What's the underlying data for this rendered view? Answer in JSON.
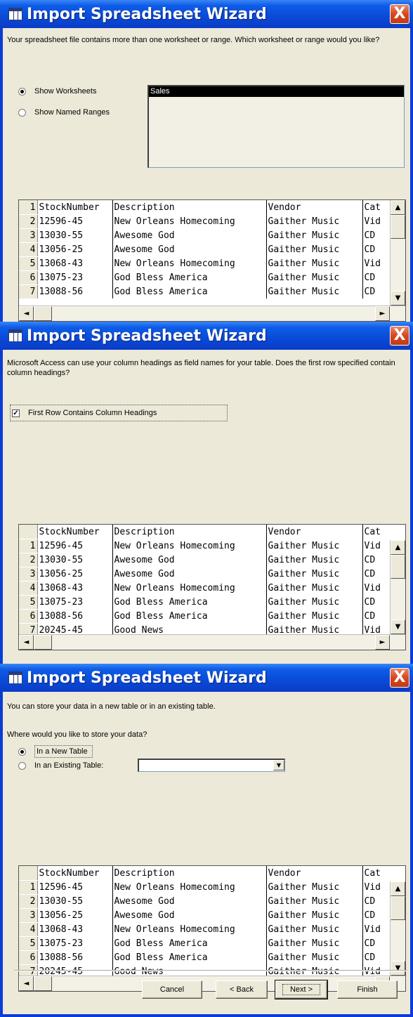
{
  "window_title": "Import Spreadsheet Wizard",
  "close_label": "X",
  "step1": {
    "prompt": "Your spreadsheet file contains more than one worksheet or range. Which worksheet or range would you like?",
    "radio_worksheets": "Show Worksheets",
    "radio_named_ranges": "Show Named Ranges",
    "selected_option": "Show Worksheets",
    "list_items": [
      "Sales"
    ],
    "grid_rows": [
      {
        "n": "1",
        "c": [
          "StockNumber",
          "Description",
          "Vendor",
          "Cat"
        ]
      },
      {
        "n": "2",
        "c": [
          "12596-45",
          "New Orleans Homecoming",
          "Gaither Music",
          "Vid"
        ]
      },
      {
        "n": "3",
        "c": [
          "13030-55",
          "Awesome God",
          "Gaither Music",
          "CD"
        ]
      },
      {
        "n": "4",
        "c": [
          "13056-25",
          "Awesome God",
          "Gaither Music",
          "CD"
        ]
      },
      {
        "n": "5",
        "c": [
          "13068-43",
          "New Orleans Homecoming",
          "Gaither Music",
          "Vid"
        ]
      },
      {
        "n": "6",
        "c": [
          "13075-23",
          "God Bless America",
          "Gaither Music",
          "CD"
        ]
      },
      {
        "n": "7",
        "c": [
          "13088-56",
          "God Bless America",
          "Gaither Music",
          "CD"
        ]
      }
    ]
  },
  "step2": {
    "prompt": "Microsoft Access can use your column headings as field names for your table. Does the first row specified contain column headings?",
    "checkbox_label": "First Row Contains Column Headings",
    "checkbox_checked": true,
    "grid_header": [
      "StockNumber",
      "Description",
      "Vendor",
      "Cat"
    ],
    "grid_rows": [
      {
        "n": "1",
        "c": [
          "12596-45",
          "New Orleans Homecoming",
          "Gaither Music",
          "Vid"
        ]
      },
      {
        "n": "2",
        "c": [
          "13030-55",
          "Awesome God",
          "Gaither Music",
          "CD"
        ]
      },
      {
        "n": "3",
        "c": [
          "13056-25",
          "Awesome God",
          "Gaither Music",
          "CD"
        ]
      },
      {
        "n": "4",
        "c": [
          "13068-43",
          "New Orleans Homecoming",
          "Gaither Music",
          "Vid"
        ]
      },
      {
        "n": "5",
        "c": [
          "13075-23",
          "God Bless America",
          "Gaither Music",
          "CD"
        ]
      },
      {
        "n": "6",
        "c": [
          "13088-56",
          "God Bless America",
          "Gaither Music",
          "CD"
        ]
      },
      {
        "n": "7",
        "c": [
          "20245-45",
          "Good News",
          "Gaither Music",
          "Vid"
        ]
      }
    ]
  },
  "step3": {
    "prompt1": "You can store your data in a new table or in an existing table.",
    "prompt2": "Where would you like to store your data?",
    "radio_new_table": "In a New Table",
    "radio_existing_table": "In an Existing Table:",
    "selected_option": "In a New Table",
    "existing_table_value": "",
    "grid_header": [
      "StockNumber",
      "Description",
      "Vendor",
      "Cat"
    ],
    "grid_rows": [
      {
        "n": "1",
        "c": [
          "12596-45",
          "New Orleans Homecoming",
          "Gaither Music",
          "Vid"
        ]
      },
      {
        "n": "2",
        "c": [
          "13030-55",
          "Awesome God",
          "Gaither Music",
          "CD"
        ]
      },
      {
        "n": "3",
        "c": [
          "13056-25",
          "Awesome God",
          "Gaither Music",
          "CD"
        ]
      },
      {
        "n": "4",
        "c": [
          "13068-43",
          "New Orleans Homecoming",
          "Gaither Music",
          "Vid"
        ]
      },
      {
        "n": "5",
        "c": [
          "13075-23",
          "God Bless America",
          "Gaither Music",
          "CD"
        ]
      },
      {
        "n": "6",
        "c": [
          "13088-56",
          "God Bless America",
          "Gaither Music",
          "CD"
        ]
      },
      {
        "n": "7",
        "c": [
          "20245-45",
          "Good News",
          "Gaither Music",
          "Vid"
        ]
      }
    ]
  },
  "buttons": {
    "cancel": "Cancel",
    "back": "< Back",
    "next": "Next >",
    "finish": "Finish"
  },
  "scroll_glyphs": {
    "up": "▲",
    "down": "▼",
    "left": "◄",
    "right": "►",
    "combo": "▼"
  }
}
